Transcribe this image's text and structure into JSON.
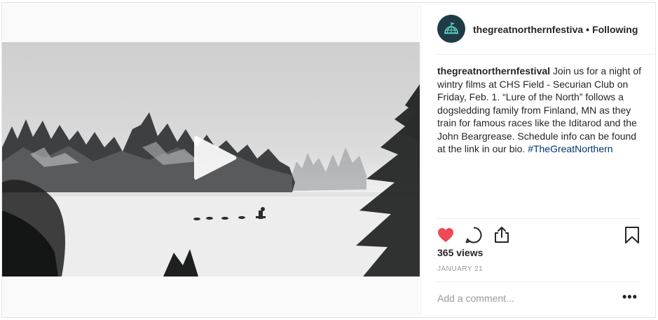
{
  "post": {
    "username": "thegreatnorthernfestiva",
    "follow_sep": "•",
    "follow_status": "Following",
    "caption_user": "thegreatnorthernfestival",
    "caption_text": " Join us for a night of wintry films at CHS Field - Securian Club on Friday, Feb. 1. “Lure of the North” follows a dogsledding family from Finland, MN as they train for famous races like the Iditarod and the John Beargrease. Schedule info can be found at the link in our bio. ",
    "hashtag": "#TheGreatNorthern",
    "views": "365 views",
    "date": "JANUARY 21",
    "comment_placeholder": "Add a comment...",
    "more_label": "•••"
  },
  "colors": {
    "like": "#ed4956",
    "avatar_bg": "#1f3b46",
    "avatar_icon": "#5fd0c0",
    "hashtag": "#003569",
    "muted": "#999999"
  },
  "icons": {
    "avatar": "globe-flag-icon",
    "play": "play-icon",
    "like": "heart-icon",
    "comment": "comment-icon",
    "share": "share-icon",
    "save": "bookmark-icon",
    "more": "more-options-icon"
  }
}
